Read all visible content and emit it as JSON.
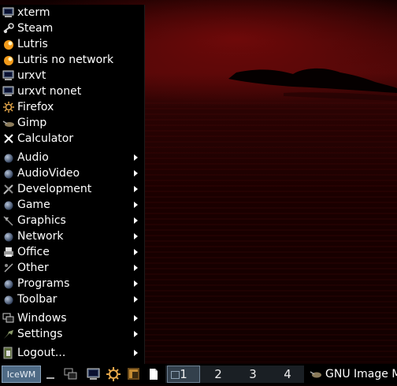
{
  "menu": {
    "items": [
      {
        "label": "xterm",
        "icon": "terminal-icon",
        "submenu": false
      },
      {
        "label": "Steam",
        "icon": "steam-icon",
        "submenu": false
      },
      {
        "label": "Lutris",
        "icon": "lutris-icon",
        "submenu": false
      },
      {
        "label": "Lutris no network",
        "icon": "lutris-icon",
        "submenu": false
      },
      {
        "label": "urxvt",
        "icon": "terminal-icon",
        "submenu": false
      },
      {
        "label": "urxvt nonet",
        "icon": "terminal-icon",
        "submenu": false
      },
      {
        "label": "Firefox",
        "icon": "firefox-icon",
        "submenu": false
      },
      {
        "label": "Gimp",
        "icon": "gimp-icon",
        "submenu": false
      },
      {
        "label": "Calculator",
        "icon": "calculator-icon",
        "submenu": false
      },
      {
        "label": "Audio",
        "icon": "folder-ball-icon",
        "submenu": true
      },
      {
        "label": "AudioVideo",
        "icon": "folder-ball-icon",
        "submenu": true
      },
      {
        "label": "Development",
        "icon": "tools-icon",
        "submenu": true
      },
      {
        "label": "Game",
        "icon": "folder-ball-icon",
        "submenu": true
      },
      {
        "label": "Graphics",
        "icon": "graphics-icon",
        "submenu": true
      },
      {
        "label": "Network",
        "icon": "folder-ball-icon",
        "submenu": true
      },
      {
        "label": "Office",
        "icon": "printer-icon",
        "submenu": true
      },
      {
        "label": "Other",
        "icon": "other-icon",
        "submenu": true
      },
      {
        "label": "Programs",
        "icon": "folder-ball-icon",
        "submenu": true
      },
      {
        "label": "Toolbar",
        "icon": "folder-ball-icon",
        "submenu": true
      },
      {
        "label": "Windows",
        "icon": "windows-icon",
        "submenu": true
      },
      {
        "label": "Settings",
        "icon": "settings-icon",
        "submenu": true
      },
      {
        "label": "Logout...",
        "icon": "logout-icon",
        "submenu": true
      }
    ]
  },
  "taskbar": {
    "start_label": "IceWM",
    "workspaces": [
      "1",
      "2",
      "3",
      "4"
    ],
    "active_workspace": "1",
    "task_title": "GNU Image M"
  },
  "colors": {
    "menu_bg": "#000000",
    "start_button": "#4e6a85",
    "active_workspace": "#33404c",
    "desktop_red": "#4d0707"
  }
}
